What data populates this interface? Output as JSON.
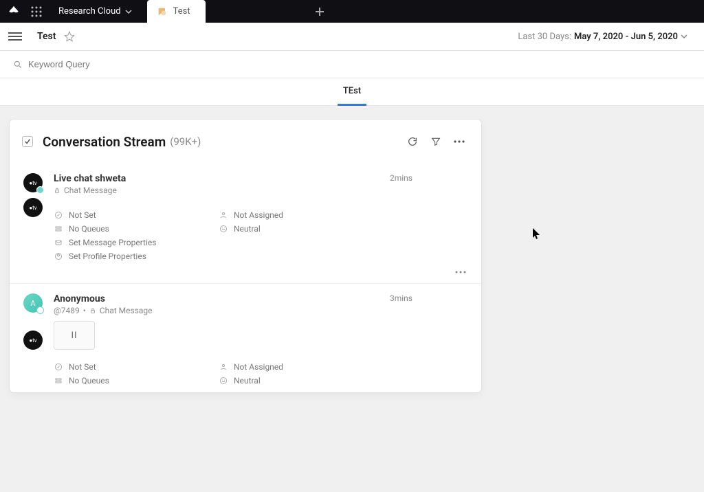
{
  "topbar": {
    "workspace_label": "Research Cloud",
    "tab_label": "Test"
  },
  "subbar": {
    "title": "Test",
    "daterange_prefix": "Last 30 Days:",
    "daterange_value": "May 7, 2020 - Jun 5, 2020"
  },
  "querybar": {
    "placeholder": "Keyword Query"
  },
  "tabs": {
    "active_label": "TEst"
  },
  "card": {
    "title": "Conversation Stream",
    "count": "(99K+)"
  },
  "items": [
    {
      "avatar_text": "●tv",
      "name": "Live chat shweta",
      "sub_type": "Chat Message",
      "time": "2mins",
      "status": "Not Set",
      "assignment": "Not Assigned",
      "queues": "No Queues",
      "sentiment": "Neutral",
      "link1": "Set Message Properties",
      "link2": "Set Profile Properties"
    },
    {
      "avatar_text": "A",
      "name": "Anonymous",
      "handle": "@7489",
      "sub_type": "Chat Message",
      "time": "3mins",
      "attachment_label": "II",
      "status": "Not Set",
      "assignment": "Not Assigned",
      "queues": "No Queues",
      "sentiment": "Neutral"
    }
  ]
}
